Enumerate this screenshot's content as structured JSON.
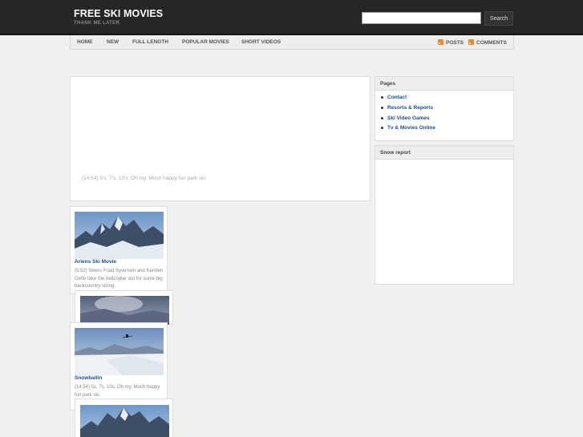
{
  "header": {
    "site_title": "FREE SKI MOVIES",
    "tagline": "THANK ME LATER",
    "search_placeholder": "",
    "search_button": "Search"
  },
  "nav": {
    "items": [
      {
        "label": "HOME"
      },
      {
        "label": "NEW"
      },
      {
        "label": "FULL LENGTH"
      },
      {
        "label": "POPULAR MOVIES"
      },
      {
        "label": "SHORT VIDEOS"
      }
    ],
    "feeds": {
      "posts": "POSTS",
      "comments": "COMMENTS"
    },
    "feed_color": "#f08a24"
  },
  "main": {
    "caption": "(14:54) 5's, 7's, 10's, Oh my. Much happy fun park ski."
  },
  "sidebar": {
    "pages": {
      "title": "Pages",
      "items": [
        {
          "label": "Contact"
        },
        {
          "label": "Resorts & Reports"
        },
        {
          "label": "Ski Video Games"
        },
        {
          "label": "Tv & Movies Online"
        }
      ]
    },
    "snow_report": {
      "title": "Snow report"
    }
  },
  "videos": [
    {
      "title": "Ariens Ski Movie",
      "description": "(5:52) Skiers Fraid Syversen and Karsten Gefle take the helicopter out for some big backcountry skiing."
    },
    {
      "title": "",
      "description": ""
    },
    {
      "title": "Snowballin",
      "description": "(14:54) 5s, 7s, 10s. Oh my. Much happy fun park ski."
    },
    {
      "title": "",
      "description": ""
    }
  ],
  "colors": {
    "header_bg": "#262626",
    "link": "#1a4c96",
    "page_bg": "#f0f0f0"
  }
}
